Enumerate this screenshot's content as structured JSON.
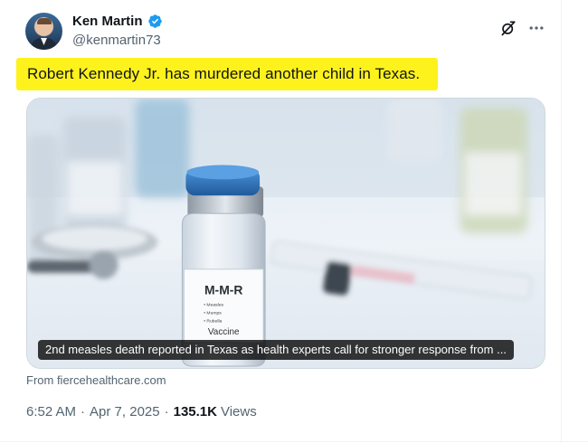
{
  "author": {
    "display_name": "Ken Martin",
    "handle": "@kenmartin73",
    "verified": true
  },
  "tweet": {
    "text": "Robert Kennedy Jr. has murdered another child in Texas.",
    "highlight_color": "#fdf21c"
  },
  "card": {
    "caption": "2nd measles death reported in Texas as health experts call for stronger response from ...",
    "image_label": {
      "title": "M-M-R",
      "lines": [
        "• Measles",
        "• Mumps",
        "• Rubella"
      ],
      "footer": "Vaccine"
    },
    "vial_cap_color": "#2f6fb3"
  },
  "source": "From fiercehealthcare.com",
  "meta": {
    "time": "6:52 AM",
    "date": "Apr 7, 2025",
    "views_count": "135.1K",
    "views_label": "Views"
  },
  "icons": {
    "grok": "grok-slash-icon",
    "more": "more-horizontal-icon",
    "verified": "verified-badge-icon"
  },
  "colors": {
    "verified_blue": "#1d9bf0",
    "secondary_text": "#536471",
    "primary_text": "#0f1419"
  }
}
